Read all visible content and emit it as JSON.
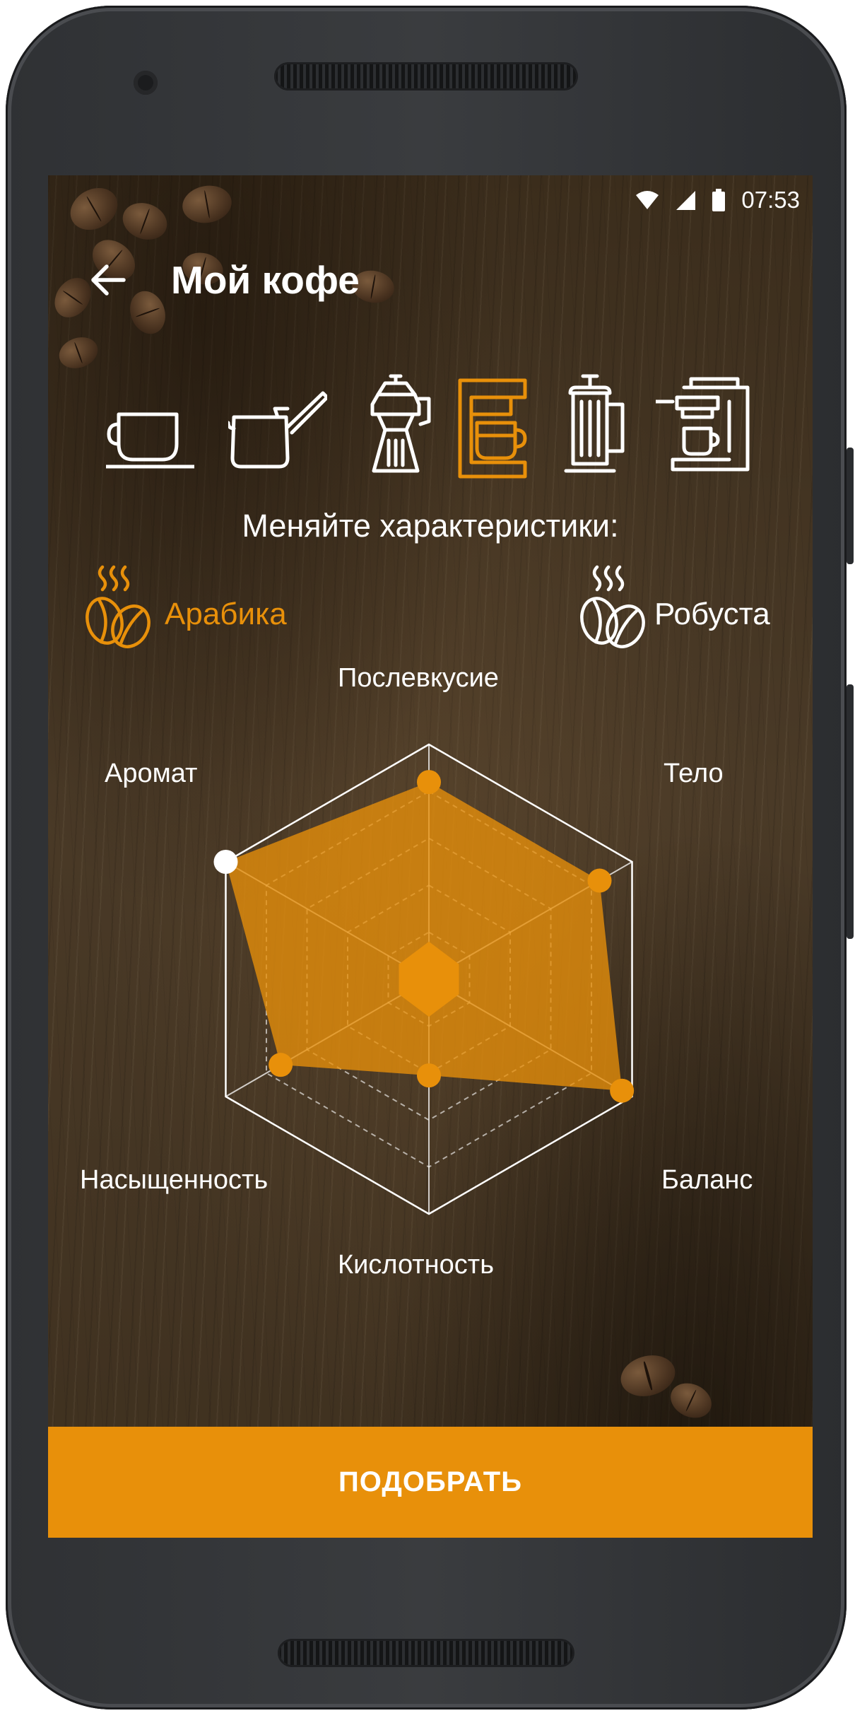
{
  "status_bar": {
    "time": "07:53",
    "icons": [
      "wifi-icon",
      "cell-signal-icon",
      "battery-icon"
    ]
  },
  "app_bar": {
    "title": "Мой кофе",
    "back_icon": "arrow-back-icon"
  },
  "brew_methods": [
    {
      "icon": "cup-icon",
      "selected": false
    },
    {
      "icon": "turk-icon",
      "selected": false
    },
    {
      "icon": "moka-pot-icon",
      "selected": false
    },
    {
      "icon": "drip-coffee-maker-icon",
      "selected": true
    },
    {
      "icon": "french-press-icon",
      "selected": false
    },
    {
      "icon": "espresso-machine-icon",
      "selected": false
    }
  ],
  "prompt": "Меняйте характеристики:",
  "varieties": [
    {
      "label": "Арабика",
      "icon": "coffee-beans-steam-icon",
      "selected": true
    },
    {
      "label": "Робуста",
      "icon": "coffee-beans-steam-icon",
      "selected": false
    }
  ],
  "chart_data": {
    "type": "radar",
    "axes": [
      "Послевкусие",
      "Тело",
      "Баланс",
      "Кислотность",
      "Насыщенность",
      "Аромат"
    ],
    "values": [
      0.84,
      0.84,
      0.95,
      0.41,
      0.73,
      1.0
    ],
    "range": [
      0,
      1
    ],
    "rings": 4,
    "active_axis": "Аромат"
  },
  "colors": {
    "accent": "#e8900a",
    "fill": "rgba(232,144,10,0.78)",
    "text": "#ffffff"
  },
  "cta": {
    "label": "ПОДОБРАТЬ"
  }
}
